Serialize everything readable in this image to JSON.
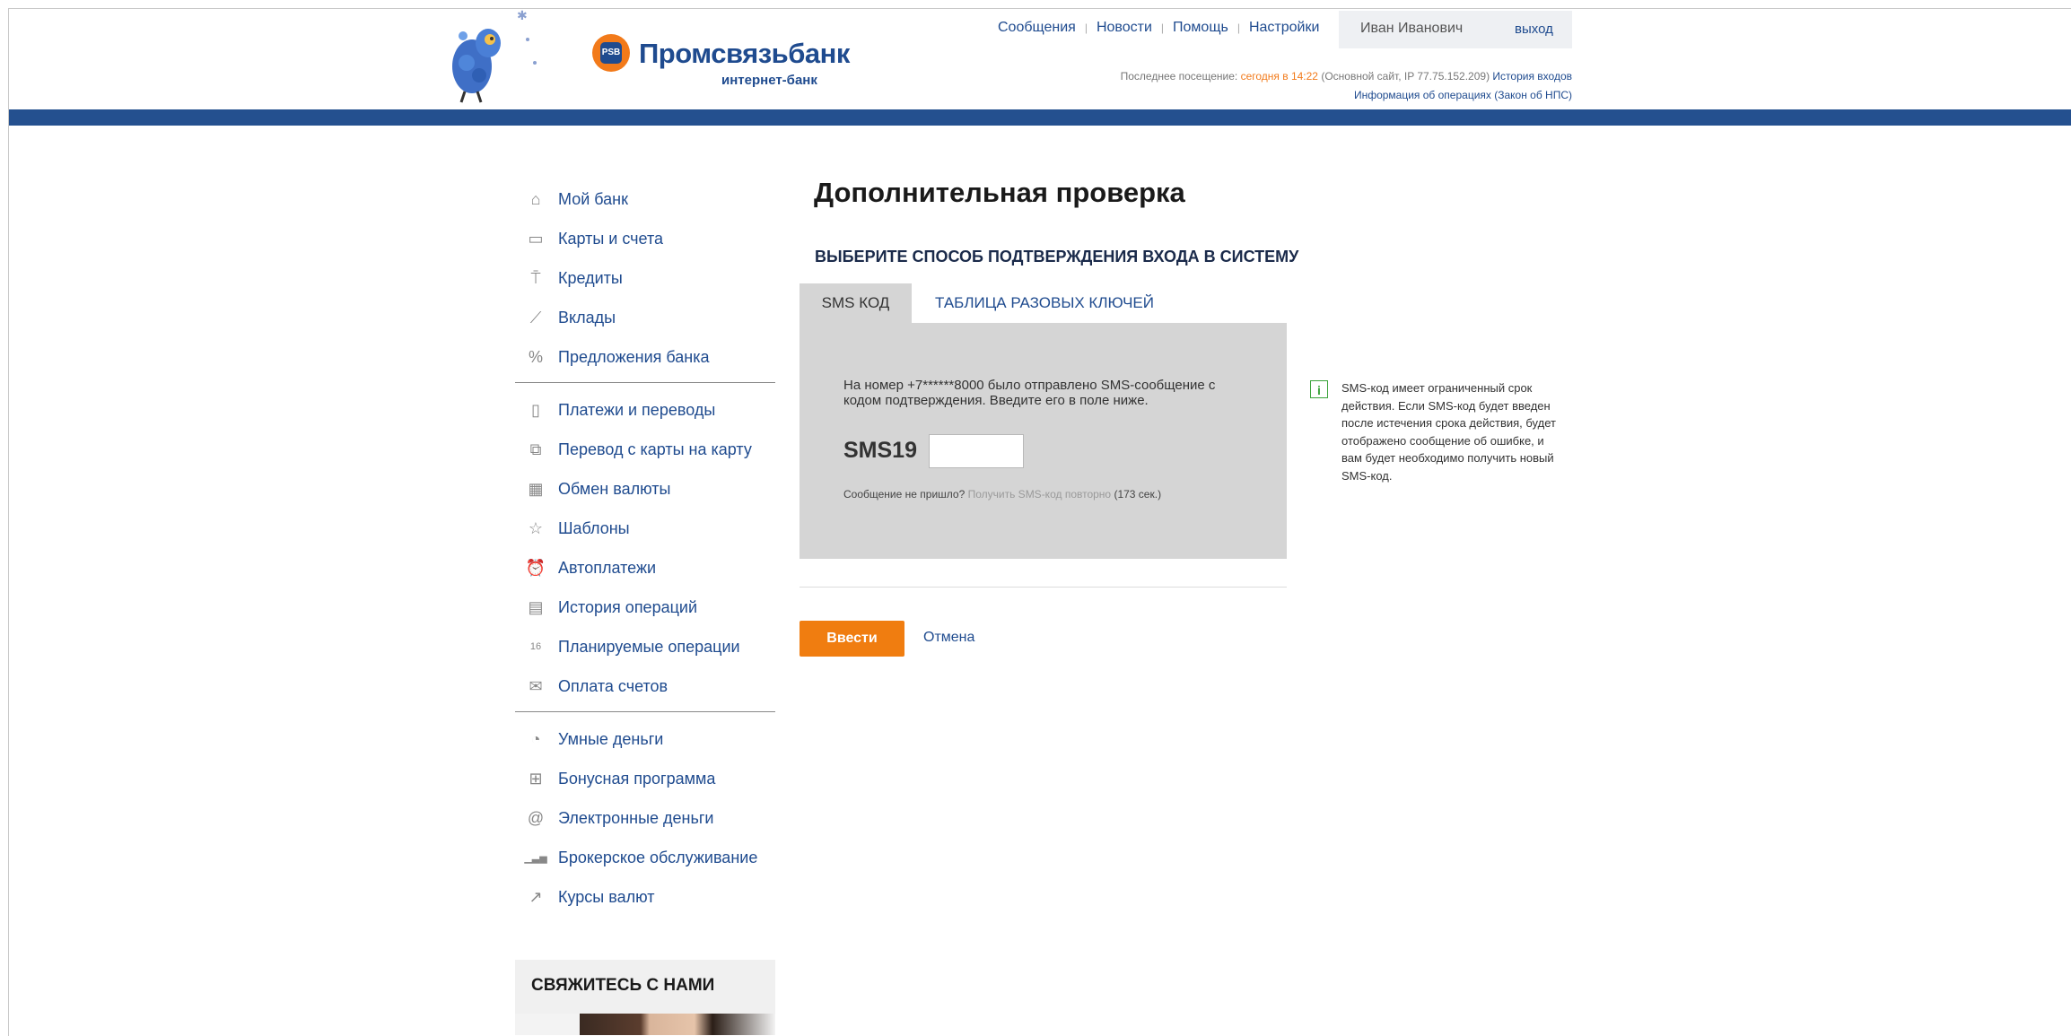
{
  "header": {
    "bank_name": "Промсвязьбанк",
    "bank_subtitle": "интернет-банк",
    "logo_mark": "PSB",
    "nav": [
      "Сообщения",
      "Новости",
      "Помощь",
      "Настройки"
    ],
    "user_name": "Иван Иванович",
    "logout_label": "выход",
    "last_visit_prefix": "Последнее посещение:",
    "last_visit_time": "сегодня в 14:22",
    "last_visit_detail": "(Основной сайт, IP 77.75.152.209)",
    "login_history_link": "История входов",
    "operations_info_link": "Информация об операциях (Закон об НПС)",
    "brand_blue": "#24508f",
    "brand_orange": "#f27a1a"
  },
  "sidebar": {
    "group1": [
      {
        "label": "Мой банк",
        "icon": "home-icon",
        "glyph": "⌂"
      },
      {
        "label": "Карты и счета",
        "icon": "card-icon",
        "glyph": "▭"
      },
      {
        "label": "Кредиты",
        "icon": "paint-roller-icon",
        "glyph": "⍑"
      },
      {
        "label": "Вклады",
        "icon": "chart-icon",
        "glyph": "⟋"
      },
      {
        "label": "Предложения банка",
        "icon": "percent-icon",
        "glyph": "%"
      }
    ],
    "group2": [
      {
        "label": "Платежи и переводы",
        "icon": "wallet-icon",
        "glyph": "▯"
      },
      {
        "label": "Перевод с карты на карту",
        "icon": "cards-icon",
        "glyph": "⧉"
      },
      {
        "label": "Обмен валюты",
        "icon": "calculator-icon",
        "glyph": "▦"
      },
      {
        "label": "Шаблоны",
        "icon": "star-icon",
        "glyph": "☆"
      },
      {
        "label": "Автоплатежи",
        "icon": "alarm-clock-icon",
        "glyph": "⏰"
      },
      {
        "label": "История операций",
        "icon": "document-icon",
        "glyph": "▤"
      },
      {
        "label": "Планируемые операции",
        "icon": "calendar-icon",
        "glyph": "16"
      },
      {
        "label": "Оплата счетов",
        "icon": "envelope-icon",
        "glyph": "✉"
      }
    ],
    "group3": [
      {
        "label": "Умные деньги",
        "icon": "pie-chart-icon",
        "glyph": "◔"
      },
      {
        "label": "Бонусная программа",
        "icon": "gift-icon",
        "glyph": "⊞"
      },
      {
        "label": "Электронные деньги",
        "icon": "email-money-icon",
        "glyph": "@"
      },
      {
        "label": "Брокерское обслуживание",
        "icon": "bar-chart-icon",
        "glyph": "▁▃▅"
      },
      {
        "label": "Курсы валют",
        "icon": "trend-icon",
        "glyph": "↗"
      }
    ],
    "contact_title": "СВЯЖИТЕСЬ С НАМИ"
  },
  "main": {
    "title": "Дополнительная проверка",
    "subheading": "ВЫБЕРИТЕ СПОСОБ ПОДТВЕРЖДЕНИЯ ВХОДА В СИСТЕМУ",
    "tabs": [
      {
        "label": "SMS КОД",
        "active": true
      },
      {
        "label": "ТАБЛИЦА РАЗОВЫХ КЛЮЧЕЙ",
        "active": false
      }
    ],
    "message": "На номер +7******8000 было отправлено SMS-сообщение с кодом подтверждения. Введите его в поле ниже.",
    "sms_label": "SMS19",
    "sms_value": "",
    "resend_prefix": "Сообщение не пришло?",
    "resend_link": "Получить SMS-код повторно",
    "resend_timer": "(173 сек.)",
    "submit_label": "Ввести",
    "cancel_label": "Отмена",
    "info_icon_glyph": "i",
    "info_text": "SMS-код имеет ограниченный срок действия. Если SMS-код будет введен после истечения срока действия, будет отображено сообщение об ошибке, и вам будет необходимо получить новый SMS-код."
  }
}
